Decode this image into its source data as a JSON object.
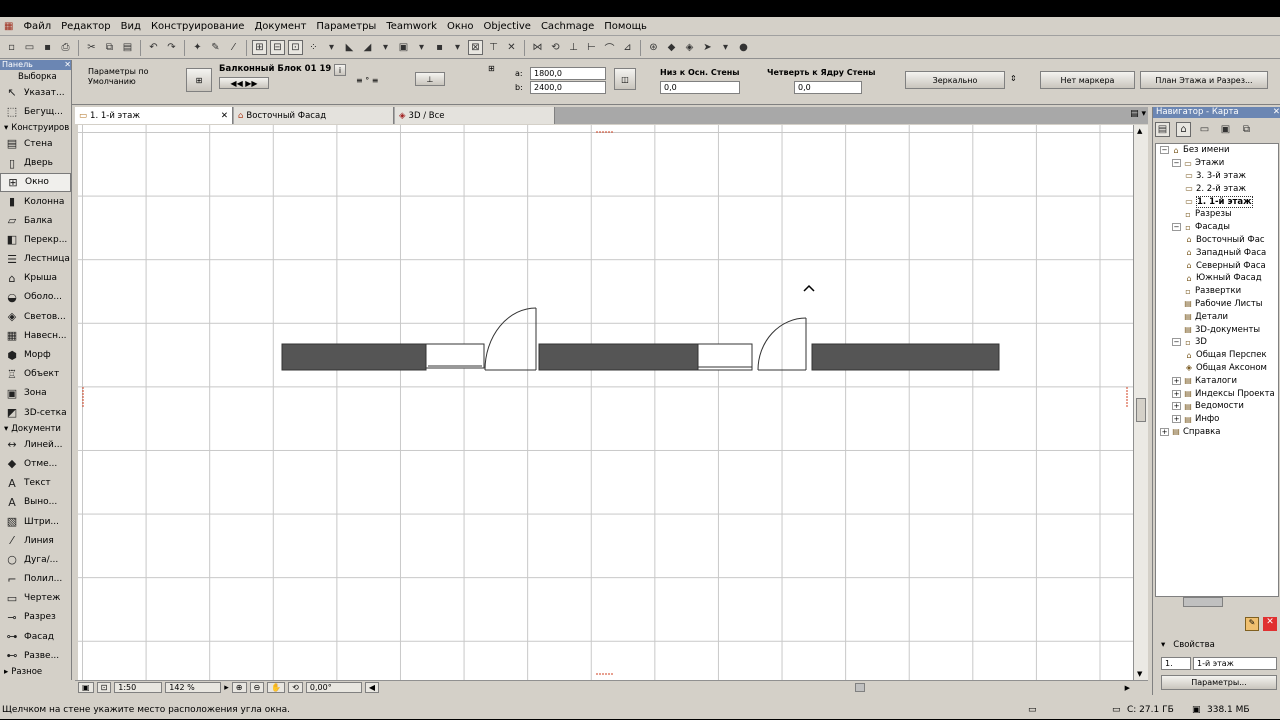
{
  "menu": [
    "Файл",
    "Редактор",
    "Вид",
    "Конструирование",
    "Документ",
    "Параметры",
    "Teamwork",
    "Окно",
    "Objective",
    "Cachmage",
    "Помощь"
  ],
  "infobox": {
    "defaults_label": "Параметры по Умолчанию",
    "element_name": "Балконный Блок 01 19",
    "width_label": "a:",
    "width_value": "1800,0",
    "height_label": "b:",
    "height_value": "2400,0",
    "sill_label": "Низ к Осн. Стены",
    "sill_value": "0,0",
    "reveal_label": "Четверть к Ядру Стены",
    "reveal_value": "0,0",
    "mirror_label": "Зеркально",
    "marker_label": "Нет маркера",
    "floorplan_label": "План Этажа и Разрез..."
  },
  "toolbox": {
    "header": "Панель",
    "select_label": "Выборка",
    "design_section": "Конструиров",
    "document_section": "Документи",
    "more_label": "Разное",
    "items": [
      {
        "label": "Указат...",
        "icon": "arrow-icon",
        "glyph": "↖"
      },
      {
        "label": "Бегущ...",
        "icon": "marquee-icon",
        "glyph": "⬚"
      },
      {
        "label": "Стена",
        "icon": "wall-icon",
        "glyph": "▤"
      },
      {
        "label": "Дверь",
        "icon": "door-icon",
        "glyph": "▯"
      },
      {
        "label": "Окно",
        "icon": "window-icon",
        "glyph": "⊞"
      },
      {
        "label": "Колонна",
        "icon": "column-icon",
        "glyph": "▮"
      },
      {
        "label": "Балка",
        "icon": "beam-icon",
        "glyph": "▱"
      },
      {
        "label": "Перекр...",
        "icon": "slab-icon",
        "glyph": "◧"
      },
      {
        "label": "Лестница",
        "icon": "stair-icon",
        "glyph": "☰"
      },
      {
        "label": "Крыша",
        "icon": "roof-icon",
        "glyph": "⌂"
      },
      {
        "label": "Оболо...",
        "icon": "shell-icon",
        "glyph": "◒"
      },
      {
        "label": "Светов...",
        "icon": "skylight-icon",
        "glyph": "◈"
      },
      {
        "label": "Навесн...",
        "icon": "curtain-wall-icon",
        "glyph": "▦"
      },
      {
        "label": "Морф",
        "icon": "morph-icon",
        "glyph": "⬢"
      },
      {
        "label": "Объект",
        "icon": "object-icon",
        "glyph": "♖"
      },
      {
        "label": "Зона",
        "icon": "zone-icon",
        "glyph": "▣"
      },
      {
        "label": "3D-сетка",
        "icon": "mesh-icon",
        "glyph": "◩"
      }
    ],
    "doc_items": [
      {
        "label": "Линей...",
        "icon": "dimension-icon",
        "glyph": "↔"
      },
      {
        "label": "Отме...",
        "icon": "level-icon",
        "glyph": "◆"
      },
      {
        "label": "Текст",
        "icon": "text-icon",
        "glyph": "A"
      },
      {
        "label": "Выно...",
        "icon": "label-icon",
        "glyph": "A"
      },
      {
        "label": "Штри...",
        "icon": "hatch-icon",
        "glyph": "▧"
      },
      {
        "label": "Линия",
        "icon": "line-icon",
        "glyph": "⁄"
      },
      {
        "label": "Дуга/...",
        "icon": "arc-icon",
        "glyph": "○"
      },
      {
        "label": "Полил...",
        "icon": "polyline-icon",
        "glyph": "⌐"
      },
      {
        "label": "Чертеж",
        "icon": "drawing-icon",
        "glyph": "▭"
      },
      {
        "label": "Разрез",
        "icon": "section-icon",
        "glyph": "⊸"
      },
      {
        "label": "Фасад",
        "icon": "elevation-icon",
        "glyph": "⊶"
      },
      {
        "label": "Разве...",
        "icon": "interior-icon",
        "glyph": "⊷"
      }
    ]
  },
  "tabs": [
    {
      "label": "1. 1-й этаж",
      "icon": "floor-icon"
    },
    {
      "label": "Восточный Фасад",
      "icon": "facade-icon"
    },
    {
      "label": "3D / Все",
      "icon": "3d-icon"
    }
  ],
  "zoom": {
    "scale": "1:50",
    "percent": "142 %",
    "angle": "0,00°"
  },
  "navigator": {
    "header": "Навигатор - Карта",
    "props_label": "Свойства",
    "story_num": "1.",
    "story_name": "1-й этаж",
    "params_button": "Параметры...",
    "tree": [
      {
        "label": "Без имени",
        "level": 0,
        "icon": "house-icon"
      },
      {
        "label": "Этажи",
        "level": 1,
        "icon": "stories-icon"
      },
      {
        "label": "3. 3-й этаж",
        "level": 2,
        "icon": "story-icon"
      },
      {
        "label": "2. 2-й этаж",
        "level": 2,
        "icon": "story-icon"
      },
      {
        "label": "1. 1-й этаж",
        "level": 2,
        "icon": "story-icon",
        "bold": true
      },
      {
        "label": "Разрезы",
        "level": 1,
        "icon": "sections-icon"
      },
      {
        "label": "Фасады",
        "level": 1,
        "icon": "elevations-icon"
      },
      {
        "label": "Восточный Фас",
        "level": 2,
        "icon": "facade-icon"
      },
      {
        "label": "Западный Фаса",
        "level": 2,
        "icon": "facade-icon"
      },
      {
        "label": "Северный Фаса",
        "level": 2,
        "icon": "facade-icon"
      },
      {
        "label": "Южный Фасад",
        "level": 2,
        "icon": "facade-icon"
      },
      {
        "label": "Развертки",
        "level": 1,
        "icon": "interior-elev-icon"
      },
      {
        "label": "Рабочие Листы",
        "level": 1,
        "icon": "worksheet-icon"
      },
      {
        "label": "Детали",
        "level": 1,
        "icon": "detail-icon"
      },
      {
        "label": "3D-документы",
        "level": 1,
        "icon": "3d-doc-icon"
      },
      {
        "label": "3D",
        "level": 1,
        "icon": "3d-icon"
      },
      {
        "label": "Общая Перспек",
        "level": 2,
        "icon": "perspective-icon"
      },
      {
        "label": "Общая Аксоном",
        "level": 2,
        "icon": "axonometry-icon"
      },
      {
        "label": "Каталоги",
        "level": 1,
        "icon": "catalog-icon"
      },
      {
        "label": "Индексы Проекта",
        "level": 1,
        "icon": "index-icon"
      },
      {
        "label": "Ведомости",
        "level": 1,
        "icon": "schedule-icon"
      },
      {
        "label": "Инфо",
        "level": 1,
        "icon": "info-icon"
      },
      {
        "label": "Справка",
        "level": 0,
        "icon": "help-icon"
      }
    ]
  },
  "status": {
    "message": "Щелчком на стене укажите место расположения угла окна.",
    "disk": "C: 27.1 ГБ",
    "memory": "338.1 МБ"
  }
}
